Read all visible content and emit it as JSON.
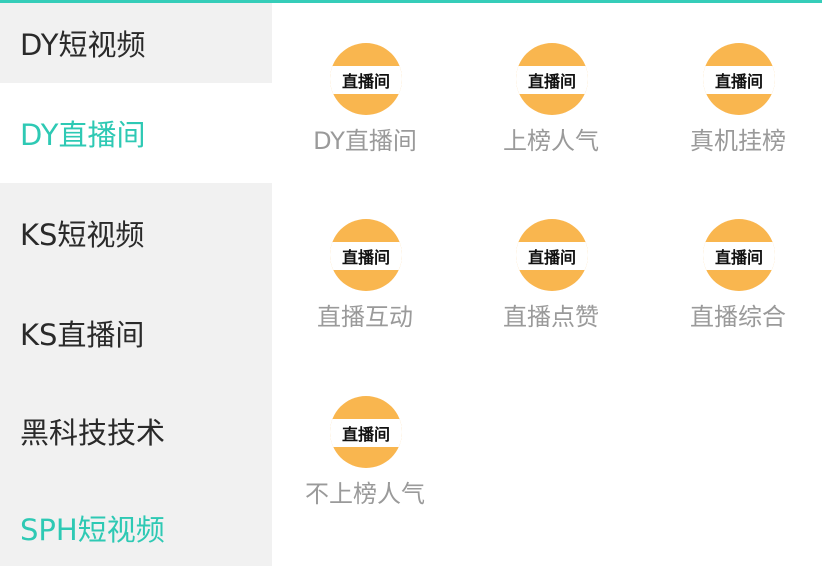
{
  "sidebar": {
    "items": [
      {
        "label": "DY短视频"
      },
      {
        "label": "DY直播间"
      },
      {
        "label": "KS短视频"
      },
      {
        "label": "KS直播间"
      },
      {
        "label": "黑科技技术"
      },
      {
        "label": "SPH短视频"
      }
    ]
  },
  "grid": {
    "badge_text": "直播间",
    "tiles": [
      {
        "label": "DY直播间"
      },
      {
        "label": "上榜人气"
      },
      {
        "label": "真机挂榜"
      },
      {
        "label": "直播互动"
      },
      {
        "label": "直播点赞"
      },
      {
        "label": "直播综合"
      },
      {
        "label": "不上榜人气"
      }
    ]
  },
  "colors": {
    "accent": "#2ec9b4",
    "badge": "#f9b64f",
    "sidebar_bg": "#f1f1f1"
  }
}
